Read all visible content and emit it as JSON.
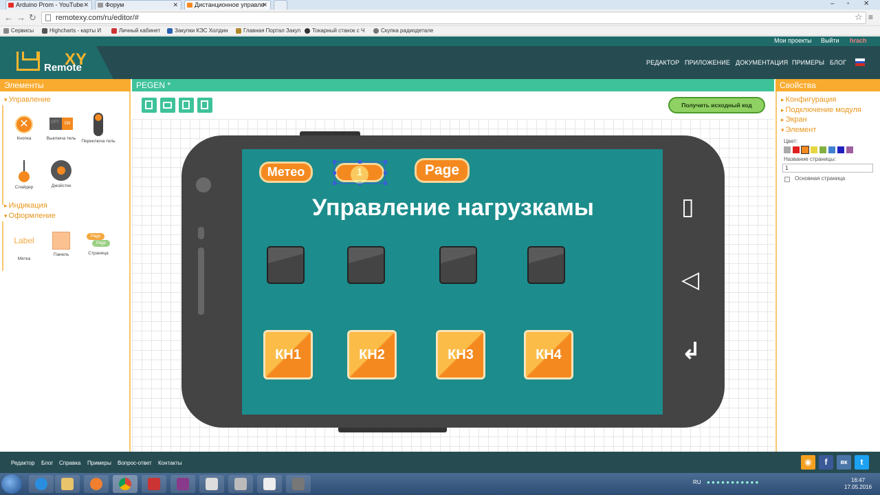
{
  "browser": {
    "tabs": [
      {
        "label": "Arduino Prom - YouTube",
        "color": "#e52d27"
      },
      {
        "label": "Форум",
        "color": "#999999"
      },
      {
        "label": "Дистанционное управле",
        "color": "#f4891f"
      }
    ],
    "url": "remotexy.com/ru/editor/#",
    "bookmarks": [
      "Сервисы",
      "Highcharts - карты И",
      "Личный кабинет",
      "Закупки КЭС Холдин",
      "Главная Портал Закуп",
      "Токарный станок с Ч",
      "Скупка радиодетале"
    ]
  },
  "site": {
    "top_links": {
      "projects": "Мои проекты",
      "logout": "Выйти",
      "user": "hrach"
    },
    "logo": {
      "remote": "Remote",
      "xy": "XY"
    },
    "nav": [
      "РЕДАКТОР",
      "ПРИЛОЖЕНИЕ",
      "ДОКУМЕНТАЦИЯ",
      "ПРИМЕРЫ",
      "БЛОГ"
    ]
  },
  "left": {
    "title": "Элементы",
    "sections": {
      "control": "Управление",
      "indication": "Индикация",
      "design": "Оформление"
    },
    "controls": [
      "Кнопка",
      "Выключа тель",
      "Переключа тель",
      "Слайдер",
      "Джойстик"
    ],
    "switch_off": "OFF",
    "switch_on": "ON",
    "design": [
      "Метка",
      "Панель",
      "Страница"
    ],
    "label_preview": "Label",
    "page_preview": "Page"
  },
  "center": {
    "title": "PEGEN *",
    "get_code": "Получить исходный код",
    "phone": {
      "page_buttons": [
        "Метео",
        "1",
        "Page"
      ],
      "heading": "Управление нагрузкамы",
      "buttons": [
        "КН1",
        "КН2",
        "КН3",
        "КН4"
      ],
      "sys_icons": [
        "▯",
        "◁",
        "↲"
      ]
    }
  },
  "right": {
    "title": "Свойства",
    "sections": [
      "Конфигурация",
      "Подключение модуля",
      "Экран",
      "Элемент"
    ],
    "color_label": "Цвет:",
    "colors": [
      "#aaaaaa",
      "#e02020",
      "#f4891f",
      "#e6d640",
      "#82b040",
      "#4080d0",
      "#2020c0",
      "#a060a0"
    ],
    "page_name_label": "Название страницы:",
    "page_name_value": "1",
    "main_page_label": "Основная страница"
  },
  "footer": {
    "links": [
      "Редактор",
      "Блог",
      "Справка",
      "Примеры",
      "Вопрос-ответ",
      "Контакты"
    ],
    "social": [
      {
        "name": "rss",
        "glyph": "◉",
        "color": "#f4a020"
      },
      {
        "name": "facebook",
        "glyph": "f",
        "color": "#3b5998"
      },
      {
        "name": "vk",
        "glyph": "вк",
        "color": "#4a76a8"
      },
      {
        "name": "twitter",
        "glyph": "t",
        "color": "#1da1f2"
      }
    ]
  },
  "taskbar": {
    "lang": "RU",
    "time": "16:47",
    "date": "17.05.2016"
  }
}
